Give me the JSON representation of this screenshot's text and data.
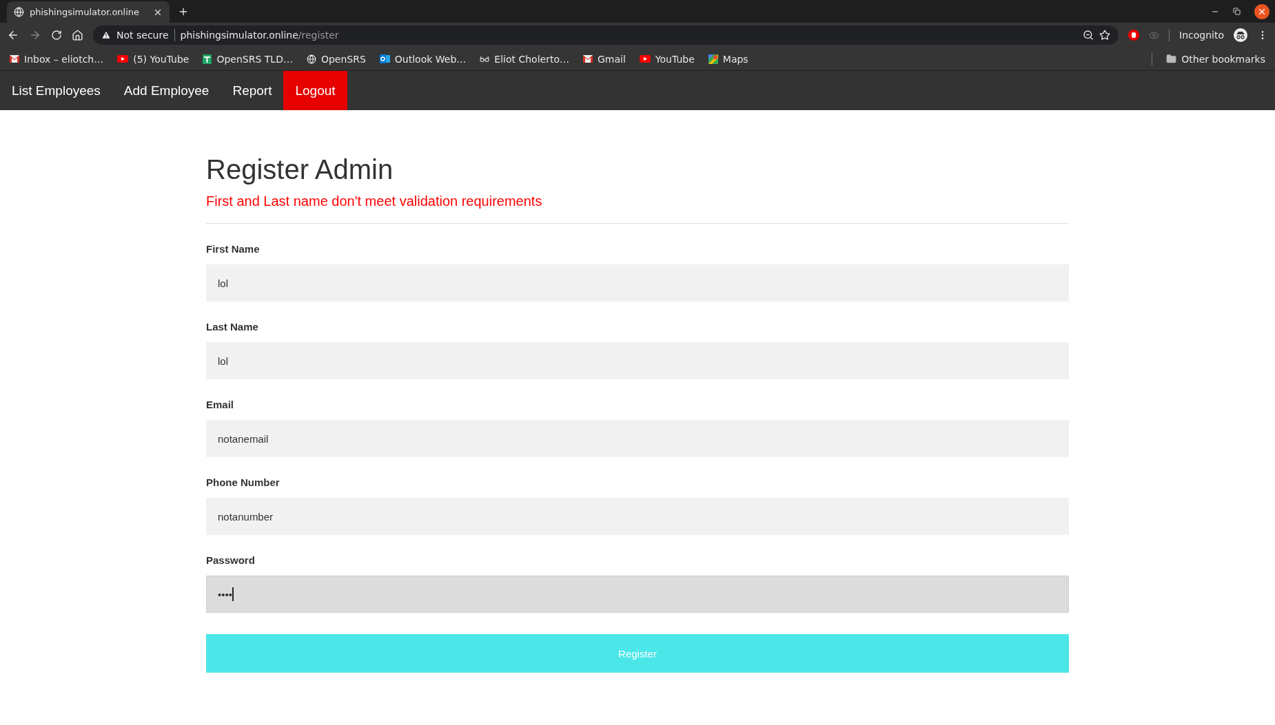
{
  "browser": {
    "tab": {
      "title": "phishingsimulator.online"
    },
    "security": "Not secure",
    "url_host": "phishingsimulator.online",
    "url_path": "/register",
    "profile": "Incognito",
    "bookmarks": [
      {
        "label": "Inbox – eliotch…",
        "kind": "mail"
      },
      {
        "label": "(5) YouTube",
        "kind": "video"
      },
      {
        "label": "OpenSRS TLD…",
        "kind": "sheet"
      },
      {
        "label": "OpenSRS",
        "kind": "globe"
      },
      {
        "label": "Outlook Web…",
        "kind": "outlook"
      },
      {
        "label": "Eliot Cholerto…",
        "kind": "glasses"
      },
      {
        "label": "Gmail",
        "kind": "mail"
      },
      {
        "label": "YouTube",
        "kind": "video"
      },
      {
        "label": "Maps",
        "kind": "maps"
      }
    ],
    "other_bookmarks": "Other bookmarks"
  },
  "nav": [
    {
      "label": "List Employees",
      "highlighted": false
    },
    {
      "label": "Add Employee",
      "highlighted": false
    },
    {
      "label": "Report",
      "highlighted": false
    },
    {
      "label": "Logout",
      "highlighted": true
    }
  ],
  "form": {
    "title": "Register Admin",
    "error": "First and Last name don't meet validation requirements",
    "fields": [
      {
        "label": "First Name",
        "value": "lol",
        "focused": false
      },
      {
        "label": "Last Name",
        "value": "lol",
        "focused": false
      },
      {
        "label": "Email",
        "value": "notanemail",
        "focused": false
      },
      {
        "label": "Phone Number",
        "value": "notanumber",
        "focused": false
      },
      {
        "label": "Password",
        "value": "••••",
        "focused": true
      }
    ],
    "submit": "Register"
  }
}
